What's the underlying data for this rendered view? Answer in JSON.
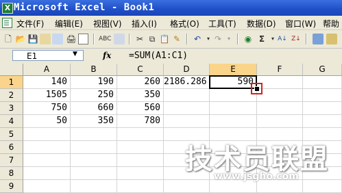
{
  "window": {
    "title": "Microsoft Excel - Book1",
    "app_icon": "X"
  },
  "menu": {
    "items": [
      "文件(F)",
      "编辑(E)",
      "视图(V)",
      "插入(I)",
      "格式(O)",
      "工具(T)",
      "数据(D)",
      "窗口(W)",
      "帮助"
    ]
  },
  "toolbar": {
    "icons": [
      "new-icon",
      "open-icon",
      "save-icon",
      "permission-icon",
      "mail-icon",
      "print-icon",
      "print-preview-icon",
      "spelling-icon",
      "research-icon",
      "cut-icon",
      "copy-icon",
      "paste-icon",
      "format-painter-icon",
      "undo-icon",
      "redo-icon",
      "insert-hyperlink-icon",
      "autosum-icon",
      "sort-ascending-icon",
      "sort-descending-icon"
    ],
    "glyphs": {
      "new": "🗋",
      "open": "📂",
      "save": "💾",
      "print": "🖨",
      "cut": "✂",
      "copy": "⧉",
      "paste": "📋",
      "undo": "↶",
      "redo": "↷",
      "sigma": "Σ",
      "sort_asc": "A↓",
      "sort_desc": "Z↓",
      "link": "🔗",
      "spell": "ABC"
    }
  },
  "formula_bar": {
    "name_box": "E1",
    "fx": "fx",
    "formula": "=SUM(A1:C1)"
  },
  "grid": {
    "columns": [
      "A",
      "B",
      "C",
      "D",
      "E",
      "F",
      "G"
    ],
    "rows": [
      "1",
      "2",
      "3",
      "4",
      "5",
      "6",
      "7",
      "8",
      "9"
    ],
    "cells": [
      [
        "140",
        "190",
        "260",
        "2186.286",
        "590",
        "",
        ""
      ],
      [
        "1505",
        "250",
        "350",
        "",
        "",
        "",
        ""
      ],
      [
        "750",
        "660",
        "560",
        "",
        "",
        "",
        ""
      ],
      [
        "50",
        "350",
        "780",
        "",
        "",
        "",
        ""
      ],
      [
        "",
        "",
        "",
        "",
        "",
        "",
        ""
      ],
      [
        "",
        "",
        "",
        "",
        "",
        "",
        ""
      ],
      [
        "",
        "",
        "",
        "",
        "",
        "",
        ""
      ],
      [
        "",
        "",
        "",
        "",
        "",
        "",
        ""
      ],
      [
        "",
        "",
        "",
        "",
        "",
        "",
        ""
      ]
    ],
    "active_cell": "E1"
  },
  "watermark": {
    "main": "技术员联盟",
    "url": "www.jsgho.com"
  }
}
